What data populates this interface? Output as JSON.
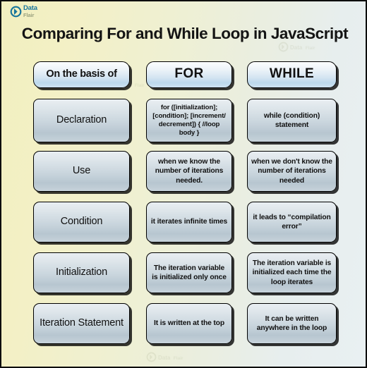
{
  "logo": {
    "icon": "dataflair-circle-icon",
    "line1": "Data",
    "line2": "Flair"
  },
  "title": "Comparing For and While Loop in JavaScript",
  "table": {
    "headers": [
      {
        "label": "On the basis of"
      },
      {
        "label": "FOR"
      },
      {
        "label": "WHILE"
      }
    ],
    "rows": [
      {
        "criterion": "Declaration",
        "for": "for ([initialization]; [condition]; [increment/ decrement]) { //loop body }",
        "while": "while (condition) statement"
      },
      {
        "criterion": "Use",
        "for": "when we know the number of iterations needed.",
        "while": "when we don't know the number of iterations needed"
      },
      {
        "criterion": "Condition",
        "for": "it iterates infinite times",
        "while": "it leads to “compilation error”"
      },
      {
        "criterion": "Initialization",
        "for": "The iteration variable is initialized only once",
        "while": "The iteration variable is initialized each time the loop iterates"
      },
      {
        "criterion": "Iteration Statement",
        "for": "It is written at the top",
        "while": "It can be written anywhere in the loop"
      }
    ]
  },
  "colors": {
    "background_left": "#f2efbf",
    "background_right": "#e9f0f2",
    "box_border": "#000000",
    "header_box_accent": "#bcd8ec",
    "body_box_accent": "#b7c6d0",
    "logo_blue": "#17759c",
    "logo_olive": "#9aa27f",
    "title_text": "#141414"
  }
}
